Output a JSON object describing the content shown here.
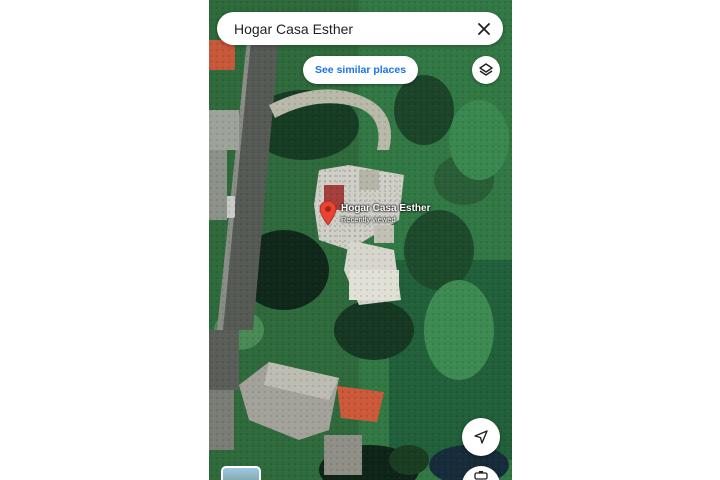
{
  "search": {
    "query": "Hogar Casa Esther"
  },
  "chip": {
    "label": "See similar places"
  },
  "place": {
    "name": "Hogar Casa Esther",
    "status": "Recently viewed"
  },
  "icons": {
    "close": "close-icon",
    "layers": "layers-icon",
    "pin": "map-pin-icon",
    "navigate": "navigation-arrow-icon",
    "bottom_action": "camera-icon"
  },
  "colors": {
    "chip_text": "#1a73e8",
    "pin": "#ea4335",
    "search_text": "#202124"
  }
}
